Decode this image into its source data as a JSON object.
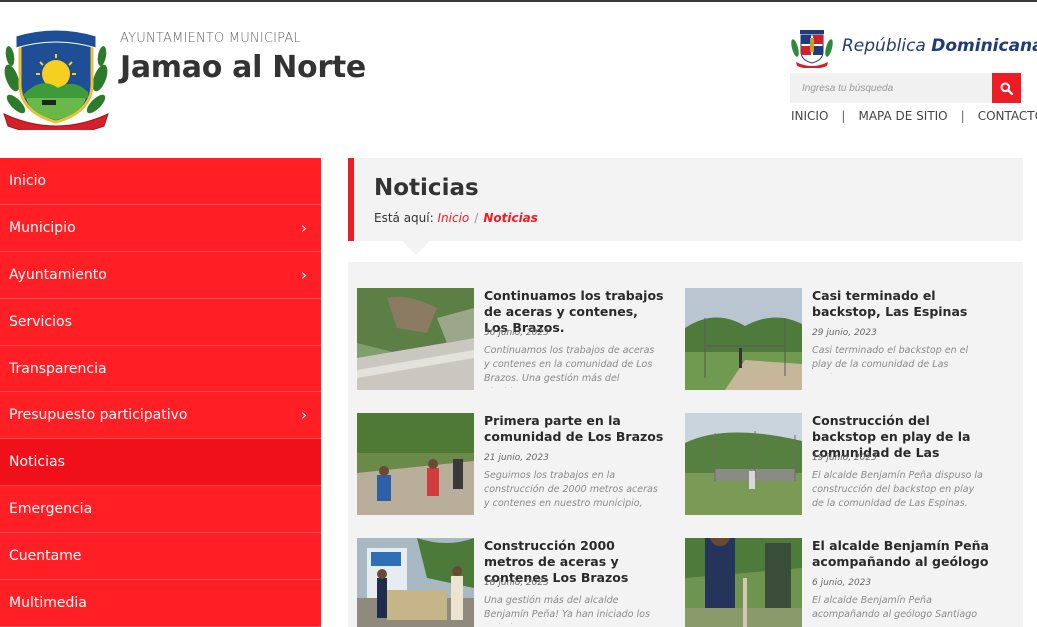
{
  "header": {
    "subtitle": "AYUNTAMIENTO MUNICIPAL",
    "title": "Jamao al Norte",
    "rd_brand_regular": "República",
    "rd_brand_bold": "Dominicana",
    "search_placeholder": "Ingresa tu búsqueda",
    "links": [
      "INICIO",
      "MAPA DE SITIO",
      "CONTACTO"
    ],
    "separator": "|",
    "logo_icon": "municipal-shield-logo",
    "rd_icon": "dominican-coat-of-arms",
    "search_icon": "magnifier-icon",
    "accent_color": "#ee1c25"
  },
  "sidebar": {
    "items": [
      {
        "label": "Inicio",
        "has_submenu": false
      },
      {
        "label": "Municipio",
        "has_submenu": true
      },
      {
        "label": "Ayuntamiento",
        "has_submenu": true
      },
      {
        "label": "Servicios",
        "has_submenu": false
      },
      {
        "label": "Transparencia",
        "has_submenu": false
      },
      {
        "label": "Presupuesto participativo",
        "has_submenu": true
      },
      {
        "label": "Noticias",
        "has_submenu": false,
        "active": true
      },
      {
        "label": "Emergencia",
        "has_submenu": false
      },
      {
        "label": "Cuentame",
        "has_submenu": false
      },
      {
        "label": "Multimedia",
        "has_submenu": false
      }
    ],
    "chevron": "›"
  },
  "page": {
    "title": "Noticias",
    "breadcrumb_prefix": "Está aquí:",
    "breadcrumb_home": "Inicio",
    "breadcrumb_sep": "/",
    "breadcrumb_current": "Noticias"
  },
  "news": [
    {
      "title": "Continuamos los trabajos de aceras y contenes, Los Brazos.",
      "date": "30 junio, 2023",
      "excerpt": "Continuamos los trabajos de aceras y contenes en la comunidad de Los Brazos. Una gestión más del alcalde…"
    },
    {
      "title": "Casi terminado el backstop, Las Espinas",
      "date": "29 junio, 2023",
      "excerpt": "Casi terminado el backstop en el play de la comunidad de Las Espinas."
    },
    {
      "title": "Primera parte en la comunidad de Los Brazos",
      "date": "21 junio, 2023",
      "excerpt": "Seguimos los trabajos en la construcción de 2000 metros aceras y contenes en nuestro municipio, esto…"
    },
    {
      "title": "Construcción del backstop en play de la comunidad de Las",
      "date": "19 junio, 2023",
      "excerpt": "El alcalde Benjamín Peña dispuso la construcción del backstop en play de la comunidad de Las Espinas. ¡Jama…"
    },
    {
      "title": "Construcción 2000 metros de aceras y contenes Los Brazos",
      "date": "18 junio, 2023",
      "excerpt": "Una gestión más del alcalde Benjamín Peña! Ya han iniciado los trabajos"
    },
    {
      "title": "El alcalde Benjamín Peña acompañando al geólogo",
      "date": "6 junio, 2023",
      "excerpt": "El alcalde Benjamín Peña acompañando al geólogo Santiago"
    }
  ]
}
